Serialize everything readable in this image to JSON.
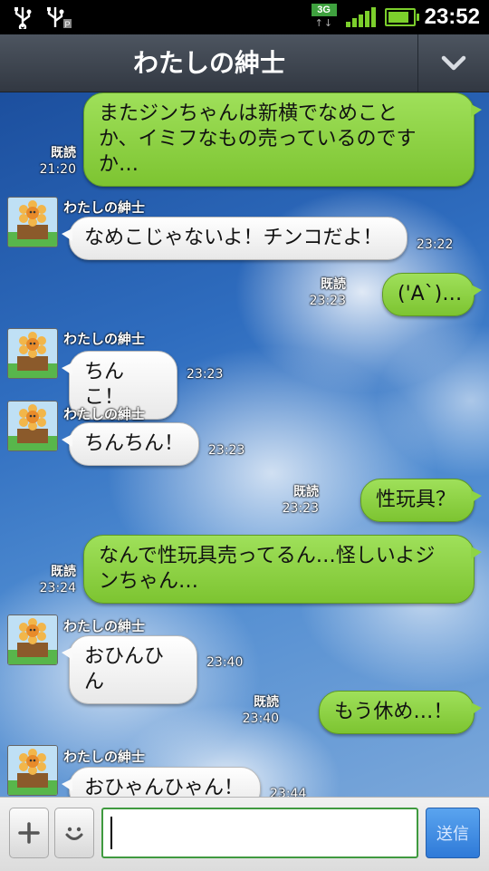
{
  "status_bar": {
    "network": "3G",
    "time": "23:52",
    "icons": [
      "usb-icon",
      "usb-debug-icon",
      "network-3g-icon",
      "signal-icon",
      "battery-icon"
    ],
    "battery_level": 0.85
  },
  "header": {
    "title": "わたしの紳士",
    "menu_icon": "chevron-down-icon"
  },
  "messages": [
    {
      "side": "sent",
      "lines": [
        "またジンちゃんは新横でなめこと",
        "か、イミフなもの売っているのです",
        "か…"
      ],
      "read": "既読",
      "time": "21:20"
    },
    {
      "side": "recv",
      "sender": "わたしの紳士",
      "lines": [
        "なめこじゃないよ！チンコだよ！"
      ],
      "time": "23:22"
    },
    {
      "side": "sent",
      "lines": [
        "('A`)…"
      ],
      "read": "既読",
      "time": "23:23"
    },
    {
      "side": "recv",
      "sender": "わたしの紳士",
      "lines": [
        "ちんこ！"
      ],
      "time": "23:23"
    },
    {
      "side": "recv",
      "sender": "わたしの紳士",
      "lines": [
        "ちんちん！"
      ],
      "time": "23:23"
    },
    {
      "side": "sent",
      "lines": [
        "性玩具？"
      ],
      "read": "既読",
      "time": "23:23"
    },
    {
      "side": "sent",
      "lines": [
        "なんで性玩具売ってるん…怪しいよジ",
        "ンちゃん…"
      ],
      "read": "既読",
      "time": "23:24"
    },
    {
      "side": "recv",
      "sender": "わたしの紳士",
      "lines": [
        "おひんひん"
      ],
      "time": "23:40"
    },
    {
      "side": "sent",
      "lines": [
        "もう休め…！"
      ],
      "read": "既読",
      "time": "23:40"
    },
    {
      "side": "recv",
      "sender": "わたしの紳士",
      "lines": [
        "おひゃんひゃん！"
      ],
      "time": "23:44"
    }
  ],
  "avatar_text": "THANK YOU",
  "input_bar": {
    "plus_icon": "plus-icon",
    "emoji_icon": "smiley-icon",
    "input_value": "",
    "send_label": "送信"
  },
  "colors": {
    "sent_bubble": "#8ed445",
    "recv_bubble": "#ffffff",
    "header_bg": "#3b424c",
    "send_button": "#3f89e0"
  }
}
